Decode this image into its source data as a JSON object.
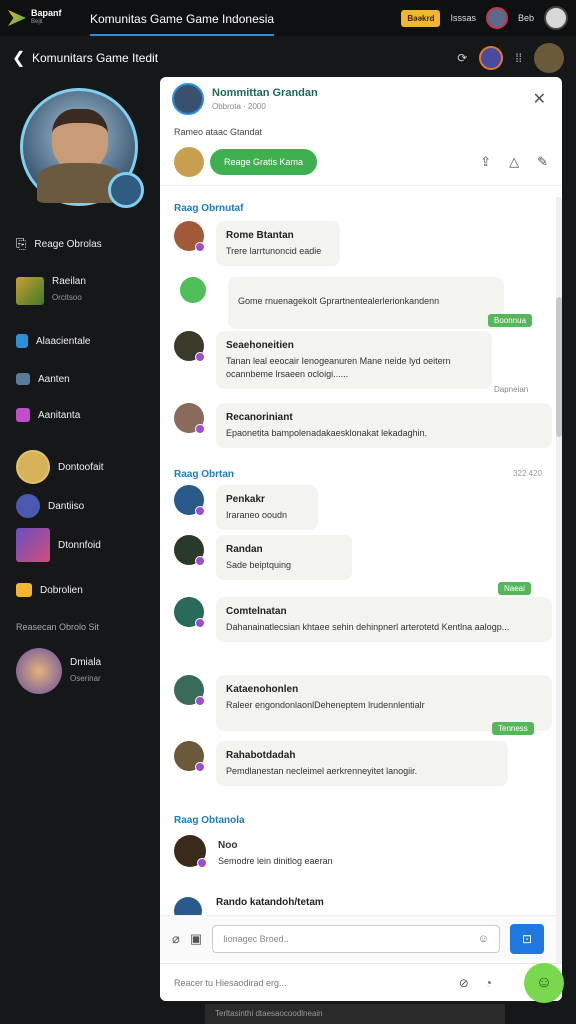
{
  "topbar": {
    "logo_title": "Bapanf",
    "logo_sub": "Bejit",
    "title": "Komunitas Game Game Indonesia",
    "badge": "Bəəkrd",
    "link1": "Isssas",
    "link2": "Beb"
  },
  "subbar": {
    "title": "Komunitars Game Itedit"
  },
  "sidebar": {
    "items": [
      {
        "label": "Reage Obrolas",
        "sub": "",
        "icon": "chat-icon"
      },
      {
        "label": "Raeilan",
        "sub": "Orcitsoo",
        "icon": "game-thumb"
      },
      {
        "label": "Alaacientale",
        "sub": "",
        "icon": "bell-icon"
      },
      {
        "label": "Aanten",
        "sub": "",
        "icon": "controller-icon"
      },
      {
        "label": "Aanitanta",
        "sub": "",
        "icon": "gift-icon"
      },
      {
        "label": "Dontoofait",
        "sub": "",
        "icon": "avatar"
      },
      {
        "label": "Dantiiso",
        "sub": "",
        "icon": "avatar"
      },
      {
        "label": "Dtonnfoid",
        "sub": "",
        "icon": "avatar"
      },
      {
        "label": "Dobrolien",
        "sub": "",
        "icon": "coin-icon"
      }
    ],
    "section_label": "Reasecan Obrolo Sit",
    "profile": {
      "name": "Dmiala",
      "sub": "Oserinar"
    }
  },
  "panel": {
    "header": {
      "name": "Nommittan Grandan",
      "meta": "Obbrota · 2000"
    },
    "subtitle": "Rameo ataac Gtandat",
    "button": "Reage Gratis Kama",
    "feed": {
      "group1": "Raag Obrnutaf",
      "group2": "Raag Obrtan",
      "group2_time": "322 420",
      "group3": "Raag Obtanola",
      "messages": [
        {
          "who": "Rome Btantan",
          "text": "Trere larrtunoncid eadie"
        },
        {
          "who": "",
          "text": "Gome rnuenagekolt Gprartnentealerlerionkandenn",
          "tag": "Boonnua"
        },
        {
          "who": "Seaehoneitien",
          "text": "Tanan leal eeocair Ienogeanuren Mane neide lyd oeitern ocannbeme lrsaeen ocloigi......",
          "stamp": "Dapneian"
        },
        {
          "who": "Recanoriniant",
          "text": "Epaonetita bampolenadakaesklonakat lekadaghin."
        },
        {
          "who": "Penkakr",
          "text": "Iraraneo ooudn"
        },
        {
          "who": "Randan",
          "text": "Sade beiptquing",
          "tag": "Naeai"
        },
        {
          "who": "Comtelnatan",
          "text": "Dahanainatlecsian khtaee sehin dehinpnerl arterotetd Kentlna aalogp..."
        },
        {
          "who": "Kataenohonlen",
          "text": "Raleer engondonlaonlDeheneptem lrudennlentialr",
          "tag": "Tenness"
        },
        {
          "who": "Rahabotdadah",
          "text": "Pemdlanestan necleimel aerkrenneyitet lanogiir."
        },
        {
          "who": "Noo",
          "text": "Semodre lein dinitlog eaeran"
        },
        {
          "who": "Rando katandoh/tetam",
          "text": ""
        }
      ]
    },
    "composer": {
      "placeholder": "Iionagec Broed..",
      "send": "⊡"
    },
    "footer": {
      "placeholder": "Reacer tu Hiesaodirad erg..."
    }
  },
  "bottom_strip": "Terltasinthi dtaesaocoodlneain",
  "colors": {
    "accent": "#1e78e0",
    "green": "#3fb04f",
    "group": "#1c7cc0"
  }
}
